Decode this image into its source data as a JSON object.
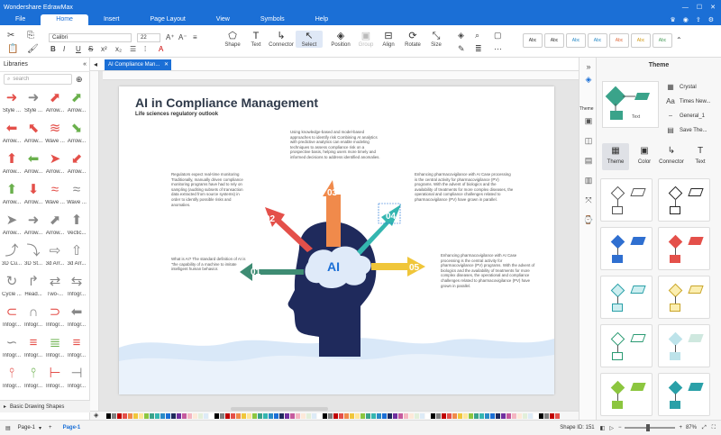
{
  "app": {
    "title": "Wondershare EdrawMax"
  },
  "menu": {
    "tabs": [
      "File",
      "Home",
      "Insert",
      "Page Layout",
      "View",
      "Symbols",
      "Help"
    ],
    "active": "Home"
  },
  "ribbon": {
    "font": "Calibri",
    "size": "22",
    "tools": [
      "Shape",
      "Text",
      "Connector",
      "Select",
      "Position",
      "Group",
      "Align",
      "Rotate",
      "Size"
    ],
    "styles": [
      "Abc",
      "Abc",
      "Abc",
      "Abc",
      "Abc",
      "Abc",
      "Abc"
    ]
  },
  "sidebar": {
    "title": "Libraries",
    "search_placeholder": "search",
    "rows": [
      [
        "Style ...",
        "Style ...",
        "Arrow...",
        "Arrow..."
      ],
      [
        "Arrow...",
        "Arrow...",
        "Wave ...",
        "Arrow..."
      ],
      [
        "Arrow...",
        "Arrow...",
        "Arrow...",
        "Arrow..."
      ],
      [
        "Arrow...",
        "Arrow...",
        "Wave ...",
        "Wave ..."
      ],
      [
        "Arrow...",
        "Arrow...",
        "Arrow...",
        "Vectic..."
      ],
      [
        "3D Cu...",
        "3D St...",
        "3d Arr...",
        "3d Arr..."
      ],
      [
        "Cycle ...",
        "Head...",
        "Two-...",
        "Infogr..."
      ],
      [
        "Infogr...",
        "Infogr...",
        "Infogr...",
        "Infogr..."
      ],
      [
        "Infogr...",
        "Infogr...",
        "Infogr...",
        "Infogr..."
      ],
      [
        "Infogr...",
        "Infogr...",
        "Infogr...",
        "Infogr..."
      ]
    ],
    "bottom": "Basic Drawing Shapes"
  },
  "document": {
    "tab": "AI Compliance Man...",
    "title": "AI in Compliance Management",
    "subtitle": "Life sciences regulatory outlook",
    "center": "AI",
    "steps": [
      "01",
      "02",
      "03",
      "04",
      "05"
    ],
    "texts": {
      "t01": "What is AI? The standard definition of AI is \"the capability of a machine to imitate intelligent human behavior.",
      "t02": "Regulators expect real-time monitoring Traditionally, manually driven compliance monitoring programs have had to rely on sampling (auditing subsets of transaction data extracted from source systems) in order to identify possible risks and anomalies.",
      "t03": "Using knowledge-based and model-based approaches to identify risk Combining AI analytics with predictive analytics can enable modeling techniques to assess compliance risk on a prospective basis, helping users more timely and informed decisions to address identified anomalies.",
      "t04": "Enhancing pharmacovigilance with AI Case processing is the central activity for pharmacovigilance (PV) programs. With the advent of biologics and the availability of treatments for more complex diseases, the operational and compliance challenges related to pharmacovigilance (PV) have grown in parallel.",
      "t05": "Enhancing pharmacovigilance with AI Case processing is the central activity for pharmacovigilance (PV) programs. With the advent of biologics and the availability of treatments for more complex diseases, the operational and compliance challenges related to pharmacovigilance (PV) have grown in parallel."
    }
  },
  "status": {
    "page_selector": "Page-1",
    "page_tab": "Page-1",
    "shape_id": "Shape ID: 151",
    "zoom": "87%"
  },
  "right_panel": {
    "title": "Theme",
    "options": [
      "Crystal",
      "Times New...",
      "General_1",
      "Save The..."
    ],
    "tabs": [
      "Theme",
      "Color",
      "Connector",
      "Text"
    ],
    "float_label": "Theme",
    "preview_text": "Text"
  },
  "colors": {
    "brand": "#1b6fd6",
    "head": "#1f2a5c",
    "cloud": "#dfeaf9",
    "c01": "#3e8c73",
    "c02": "#e4504a",
    "c03": "#f08a4b",
    "c04": "#34b6b0",
    "c05": "#f0c63a"
  }
}
